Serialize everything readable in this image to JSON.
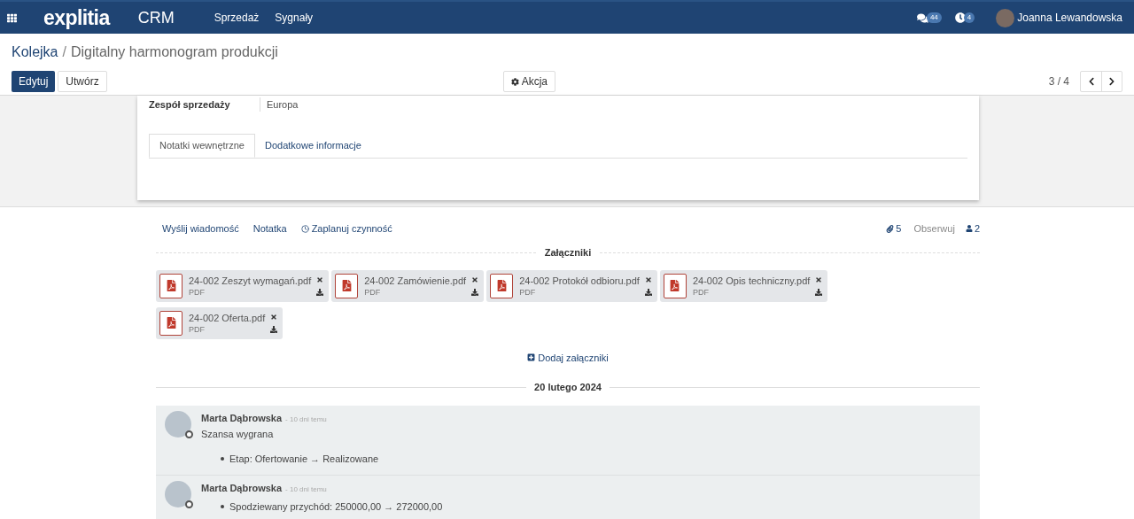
{
  "navbar": {
    "logo": "explitia",
    "app": "CRM",
    "menu": [
      "Sprzedaż",
      "Sygnały"
    ],
    "messages_count": "44",
    "activities_count": "4",
    "user": "Joanna Lewandowska"
  },
  "breadcrumb": {
    "parent": "Kolejka",
    "separator": "/",
    "current": "Digitalny harmonogram produkcji"
  },
  "buttons": {
    "edit": "Edytuj",
    "create": "Utwórz",
    "action": "Akcja"
  },
  "pager": {
    "position": "3 / 4"
  },
  "form": {
    "field_label": "Zespół sprzedaży",
    "field_value": "Europa",
    "tabs": [
      {
        "label": "Notatki wewnętrzne",
        "selected": true
      },
      {
        "label": "Dodatkowe informacje",
        "selected": false
      }
    ]
  },
  "chatter": {
    "send_message": "Wyślij wiadomość",
    "note": "Notatka",
    "schedule": "Zaplanuj czynność",
    "attachments_count": "5",
    "follow": "Obserwuj",
    "followers_count": "2",
    "attachments_title": "Załączniki",
    "attachments": [
      {
        "name": "24-002 Zeszyt wymagań.pdf",
        "type": "PDF"
      },
      {
        "name": "24-002 Zamówienie.pdf",
        "type": "PDF"
      },
      {
        "name": "24-002 Protokół odbioru.pdf",
        "type": "PDF"
      },
      {
        "name": "24-002 Opis techniczny.pdf",
        "type": "PDF"
      },
      {
        "name": "24-002 Oferta.pdf",
        "type": "PDF"
      }
    ],
    "add_attachments": "Dodaj załączniki",
    "date": "20 lutego 2024",
    "messages": [
      {
        "author": "Marta Dąbrowska",
        "time": "- 10 dni temu",
        "body": "Szansa wygrana",
        "changes": [
          "Etap: Ofertowanie → Realizowane"
        ]
      },
      {
        "author": "Marta Dąbrowska",
        "time": "- 10 dni temu",
        "changes": [
          "Spodziewany przychód: 250000,00 → 272000,00"
        ]
      }
    ]
  }
}
